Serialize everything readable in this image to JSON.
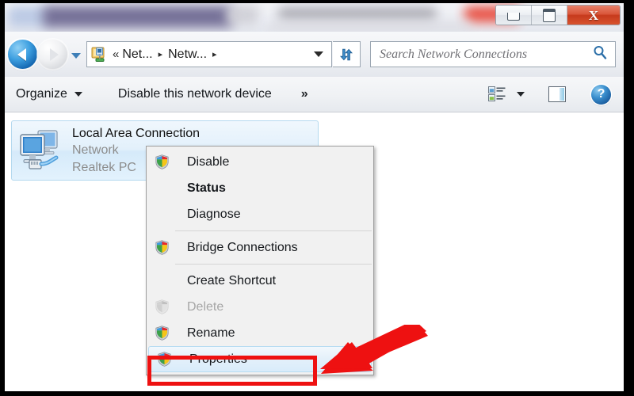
{
  "window": {
    "title_obscured": true,
    "controls": {
      "minimize": "Minimize",
      "maximize": "Maximize",
      "close": "Close",
      "close_glyph": "X"
    }
  },
  "navbar": {
    "back_label": "Back",
    "forward_label": "Forward",
    "recent_pages_label": "Recent pages",
    "breadcrumb": {
      "icon": "network-folder-icon",
      "overflow": "«",
      "items": [
        {
          "label": "Net...",
          "separator": "▸"
        },
        {
          "label": "Netw...",
          "separator": "▸"
        }
      ],
      "dropdown_label": "Previous locations"
    },
    "refresh_label": "Refresh",
    "search": {
      "placeholder": "Search Network Connections",
      "value": "",
      "icon": "search-icon"
    }
  },
  "toolbar": {
    "organize": "Organize",
    "disable_device": "Disable this network device",
    "more": "»",
    "view_icon": "change-view-icon",
    "view_caret": "view-dropdown-caret",
    "preview_pane_icon": "preview-pane-icon",
    "help_icon": "help-icon",
    "help_glyph": "?"
  },
  "connection": {
    "icon": "network-adapter-icon",
    "name": "Local Area Connection",
    "network": "Network",
    "adapter": "Realtek PC",
    "selected": true
  },
  "context_menu": {
    "items": [
      {
        "label": "Disable",
        "icon": "shield-icon",
        "bold": false,
        "disabled": false,
        "selected": false,
        "separator_after": false
      },
      {
        "label": "Status",
        "icon": "none",
        "bold": true,
        "disabled": false,
        "selected": false,
        "separator_after": false
      },
      {
        "label": "Diagnose",
        "icon": "none",
        "bold": false,
        "disabled": false,
        "selected": false,
        "separator_after": true
      },
      {
        "label": "Bridge Connections",
        "icon": "shield-icon",
        "bold": false,
        "disabled": false,
        "selected": false,
        "separator_after": true
      },
      {
        "label": "Create Shortcut",
        "icon": "none",
        "bold": false,
        "disabled": false,
        "selected": false,
        "separator_after": false
      },
      {
        "label": "Delete",
        "icon": "shield-icon-dim",
        "bold": false,
        "disabled": true,
        "selected": false,
        "separator_after": false
      },
      {
        "label": "Rename",
        "icon": "shield-icon",
        "bold": false,
        "disabled": false,
        "selected": false,
        "separator_after": false
      },
      {
        "label": "Properties",
        "icon": "shield-icon",
        "bold": false,
        "disabled": false,
        "selected": true,
        "separator_after": false
      }
    ]
  },
  "annotation": {
    "highlight_target": "Properties",
    "box_color": "#ee1111",
    "arrow_color": "#ee1111",
    "arrow_direction": "points-left-at-properties"
  }
}
